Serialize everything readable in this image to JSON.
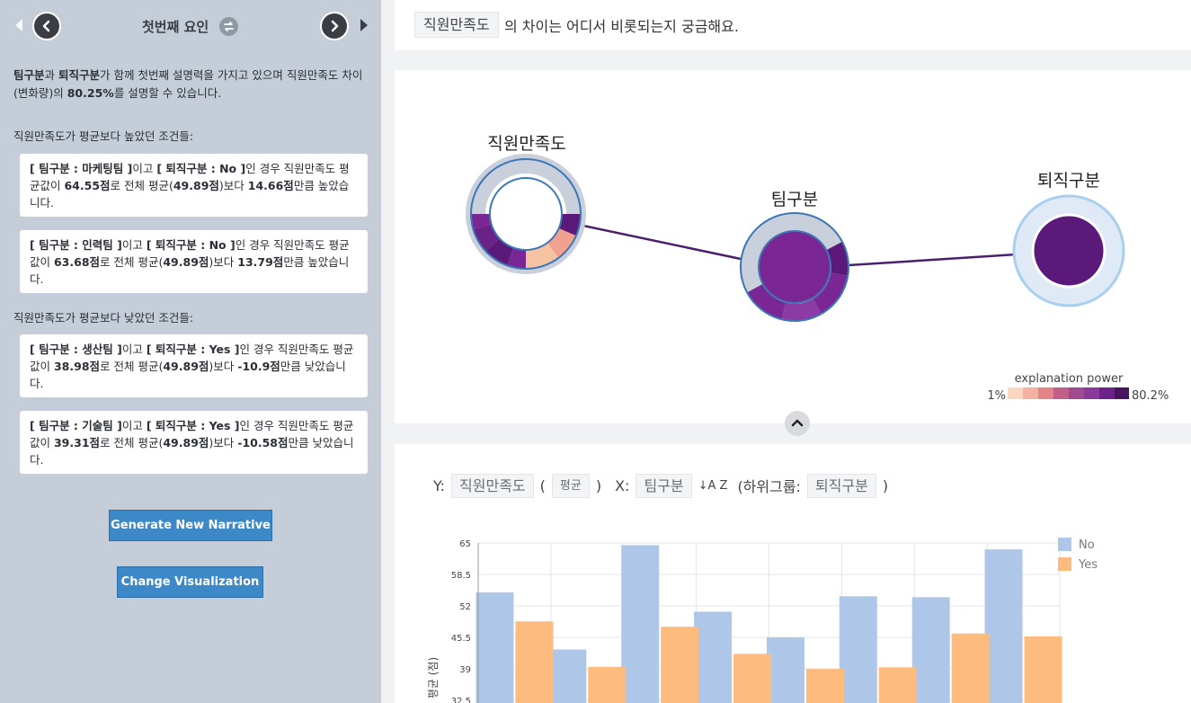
{
  "sidebar": {
    "factor_title": "첫번째 요인",
    "summary": {
      "a": "팀구분",
      "and1": "과 ",
      "b": "퇴직구분",
      "mid": "가 함께 첫번째 설명력을 가지고 있으며 직원만족도 차이(변화량)의 ",
      "pct": "80.25%",
      "end": "를 설명할 수 있습니다."
    },
    "high_label": "직원만족도가 평균보다 높았던 조건들:",
    "low_label": "직원만족도가 평균보다 낮았던 조건들:",
    "cards": [
      {
        "c1": "[ 팀구분 : 마케팅팀 ]",
        "j1": "이고 ",
        "c2": "[ 퇴직구분 : No ]",
        "t1": "인 경우 직원만족도 평균값이 ",
        "v1": "64.55점",
        "t2": "로 전체 평균(",
        "v2": "49.89점",
        "t3": ")보다 ",
        "v3": "14.66점",
        "t4": "만큼 높았습니다."
      },
      {
        "c1": "[ 팀구분 : 인력팀 ]",
        "j1": "이고 ",
        "c2": "[ 퇴직구분 : No ]",
        "t1": "인 경우 직원만족도 평균값이 ",
        "v1": "63.68점",
        "t2": "로 전체 평균(",
        "v2": "49.89점",
        "t3": ")보다 ",
        "v3": "13.79점",
        "t4": "만큼 높았습니다."
      },
      {
        "c1": "[ 팀구분 : 생산팀 ]",
        "j1": "이고 ",
        "c2": "[ 퇴직구분 : Yes ]",
        "t1": "인 경우 직원만족도 평균값이 ",
        "v1": "38.98점",
        "t2": "로 전체 평균(",
        "v2": "49.89점",
        "t3": ")보다 ",
        "v3": "-10.9점",
        "t4": "만큼 낮았습니다."
      },
      {
        "c1": "[ 팀구분 : 기술팀 ]",
        "j1": "이고 ",
        "c2": "[ 퇴직구분 : Yes ]",
        "t1": "인 경우 직원만족도 평균값이 ",
        "v1": "39.31점",
        "t2": "로 전체 평균(",
        "v2": "49.89점",
        "t3": ")보다 ",
        "v3": "-10.58점",
        "t4": "만큼 낮았습니다."
      }
    ],
    "btn_narrative": "Generate New Narrative",
    "btn_vis": "Change Visualization"
  },
  "question": {
    "tag": "직원만족도",
    "text": "의 차이는 어디서 비롯되는지 궁금해요."
  },
  "graph": {
    "nodes": {
      "target": "직원만족도",
      "team": "팀구분",
      "retire": "퇴직구분"
    },
    "legend_title": "explanation power",
    "legend_min": "1%",
    "legend_max": "80.2%",
    "colors": {
      "link": "#4a1f6e",
      "ring_base": "#c9d0dc",
      "ring_stroke": "#3c78b4",
      "purple_dark": "#5b1a7a",
      "purple": "#7a2795",
      "purple_mid": "#8c3aa6",
      "peach": "#f6c3a2",
      "salmon": "#f2a08f",
      "halo": "#dfeaf6"
    }
  },
  "controls": {
    "y_label": "Y:",
    "y_tag": "직원만족도",
    "paren_open": "(",
    "agg_tag": "평균",
    "paren_close": ")",
    "x_label": "X:",
    "x_tag": "팀구분",
    "sort_glyph": "↓A Z",
    "sub_open": "(하위그룹:",
    "sub_tag": "퇴직구분",
    "sub_close": ")"
  },
  "chart_data": {
    "type": "bar",
    "ylabel": "평균 (점)",
    "yticks": [
      "65",
      "58.5",
      "52",
      "45.5",
      "39",
      "32.5"
    ],
    "ylim": [
      32.5,
      65
    ],
    "series": [
      {
        "name": "No",
        "color": "#aec7e8",
        "values": [
          54.8,
          43.0,
          64.55,
          50.8,
          45.5,
          54.0,
          53.8,
          63.68
        ]
      },
      {
        "name": "Yes",
        "color": "#fdbb7e",
        "values": [
          48.8,
          39.4,
          47.7,
          42.1,
          38.98,
          39.31,
          46.3,
          45.7
        ]
      }
    ],
    "legend_position": "top-right",
    "grid": true
  }
}
